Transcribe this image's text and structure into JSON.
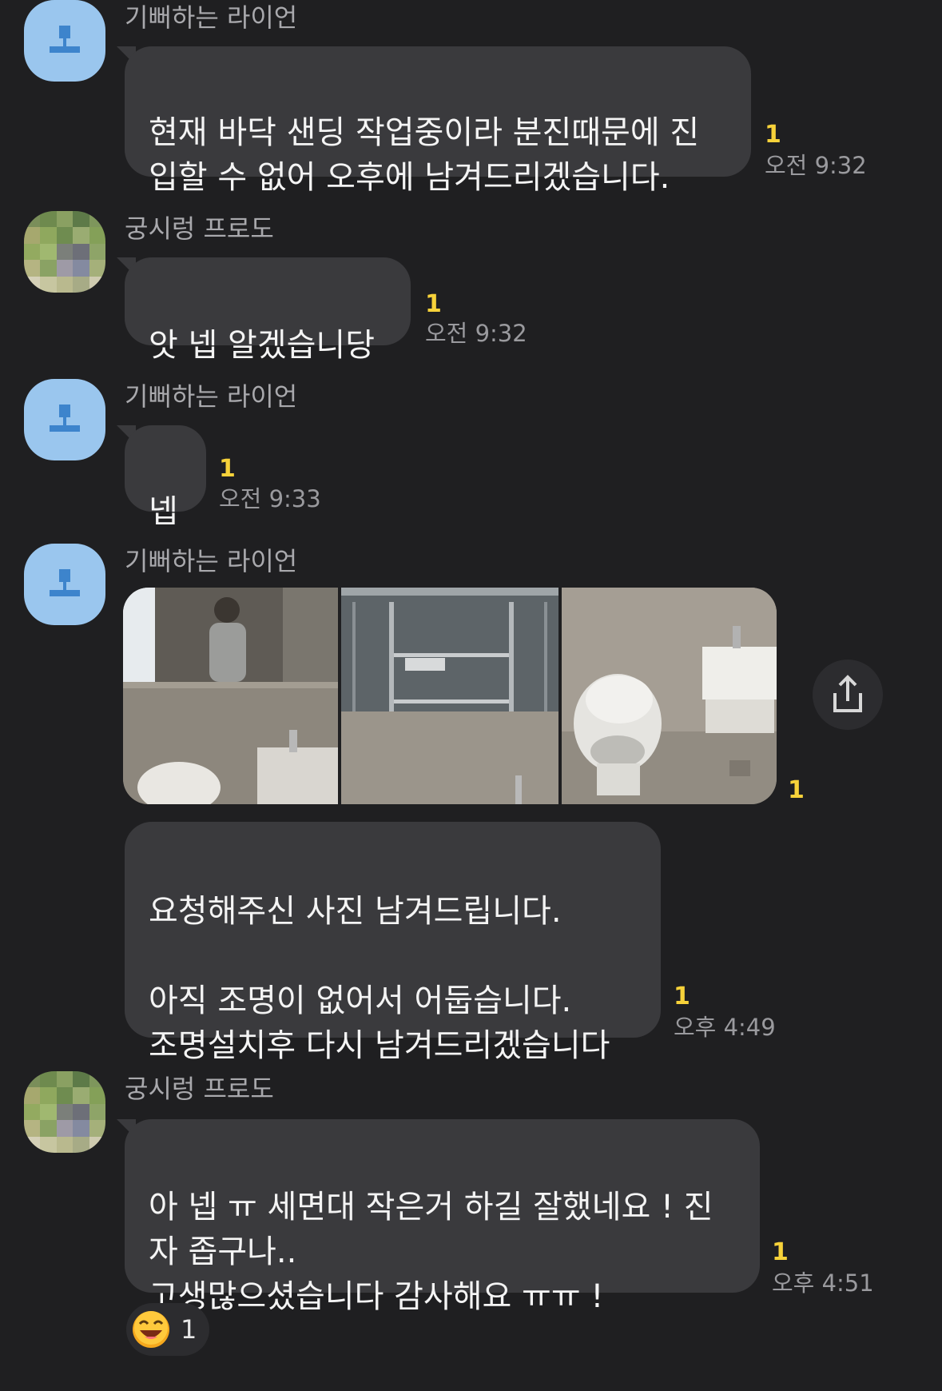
{
  "messages": [
    {
      "sender": "기뻐하는 라이언",
      "text": "현재 바닥 샌딩 작업중이라 분진때문에 진\n입할 수 없어 오후에 남겨드리겠습니다.",
      "unread": "1",
      "time": "오전 9:32"
    },
    {
      "sender": "궁시렁 프로도",
      "text": "앗 넵 알겠습니당",
      "unread": "1",
      "time": "오전 9:32"
    },
    {
      "sender": "기뻐하는 라이언",
      "text": "넵",
      "unread": "1",
      "time": "오전 9:33"
    },
    {
      "sender": "기뻐하는 라이언",
      "photos_unread": "1",
      "photos": [
        "bathroom-mirror-photo",
        "mirror-cabinet-photo",
        "toilet-sink-photo"
      ],
      "text": "요청해주신 사진 남겨드립니다.\n\n아직 조명이 없어서 어둡습니다.\n조명설치후 다시 남겨드리겠습니다",
      "unread": "1",
      "time": "오후 4:49"
    },
    {
      "sender": "궁시렁 프로도",
      "text": "아 넵 ㅠ 세면대 작은거 하길 잘했네요 ! 진\n자 좁구나..\n고생많으셨습니다 감사해요 ㅠㅠ !",
      "unread": "1",
      "time": "오후 4:51",
      "reaction": {
        "icon": "laughing-face-emoji",
        "count": "1"
      }
    }
  ],
  "icons": {
    "share": "share-icon"
  },
  "colors": {
    "background": "#1f1f21",
    "bubble": "#3a3a3d",
    "unread": "#f7d23a",
    "lion_avatar": "#9ac6ee"
  }
}
